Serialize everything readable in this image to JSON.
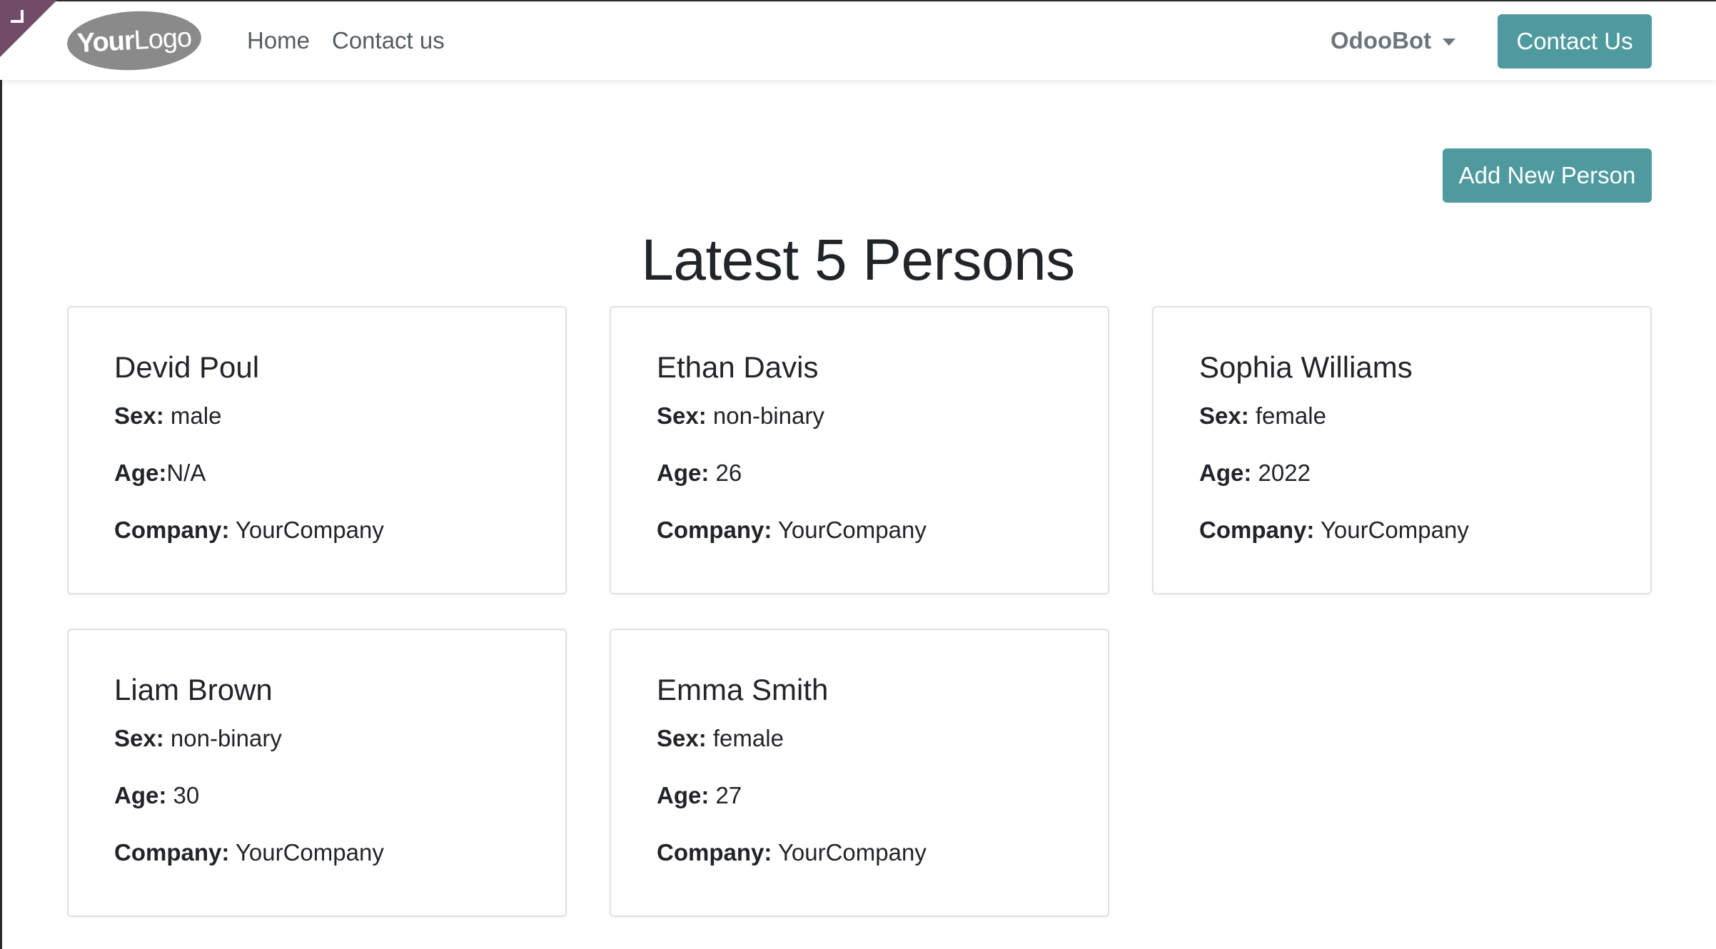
{
  "navbar": {
    "logo": {
      "bold": "Your",
      "light": "Logo"
    },
    "links": [
      {
        "label": "Home"
      },
      {
        "label": "Contact us"
      }
    ],
    "user_name": "OdooBot",
    "contact_button": "Contact Us"
  },
  "main": {
    "add_button": "Add New Person",
    "title": "Latest 5 Persons",
    "labels": {
      "sex": "Sex:",
      "age": "Age:",
      "company": "Company:"
    },
    "persons": [
      {
        "name": "Devid Poul",
        "sex": "male",
        "age": "N/A",
        "company": "YourCompany"
      },
      {
        "name": "Ethan Davis",
        "sex": "non-binary",
        "age": "26",
        "company": "YourCompany"
      },
      {
        "name": "Sophia Williams",
        "sex": "female",
        "age": "2022",
        "company": "YourCompany"
      },
      {
        "name": "Liam Brown",
        "sex": "non-binary",
        "age": "30",
        "company": "YourCompany"
      },
      {
        "name": "Emma Smith",
        "sex": "female",
        "age": "27",
        "company": "YourCompany"
      }
    ]
  },
  "colors": {
    "accent": "#4f9a9e",
    "brand": "#714b67",
    "logo_bg": "#8a8a8a"
  },
  "icons": {
    "corner": "debug-corner-icon",
    "caret": "caret-down-icon"
  }
}
